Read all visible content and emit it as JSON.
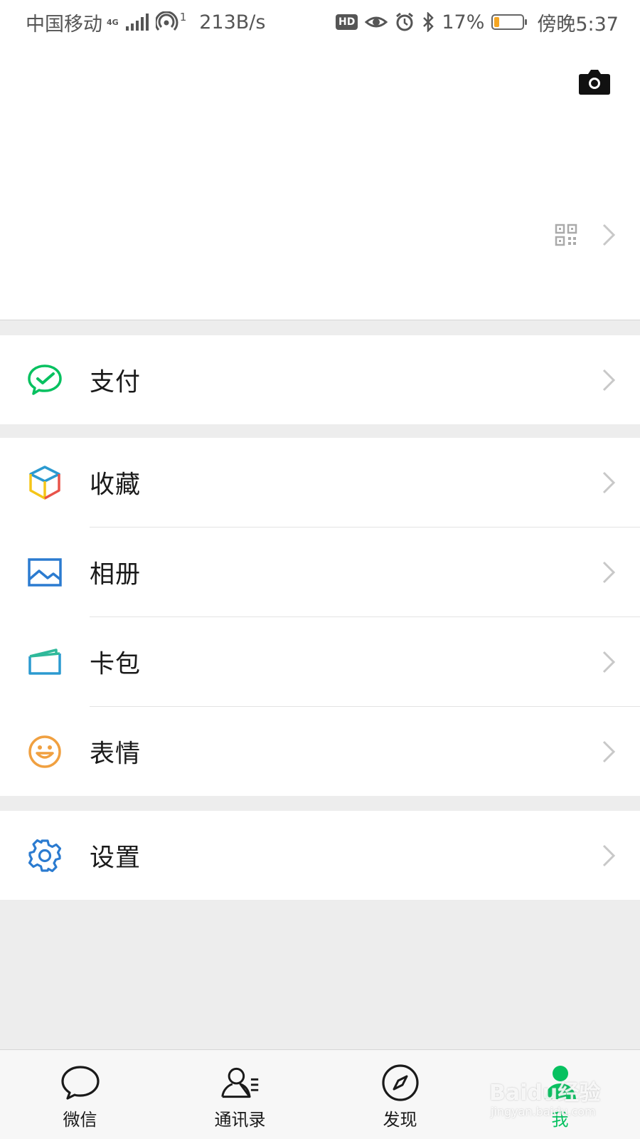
{
  "status_bar": {
    "carrier": "中国移动",
    "network": "4G",
    "hotspot_count": "1",
    "speed": "213B/s",
    "hd_badge": "HD",
    "battery_percent": "17%",
    "battery_level": 0.17,
    "time": "傍晚5:37"
  },
  "profile": {
    "camera_icon": "camera-icon",
    "qr_icon": "qr-code-icon"
  },
  "menu": {
    "pay": {
      "label": "支付",
      "icon": "wechat-pay-icon",
      "color": "#07c160"
    },
    "favorites": {
      "label": "收藏",
      "icon": "cube-icon"
    },
    "album": {
      "label": "相册",
      "icon": "picture-icon",
      "color": "#2b7bd0"
    },
    "cards": {
      "label": "卡包",
      "icon": "wallet-icon",
      "color": "#2b9ad0"
    },
    "stickers": {
      "label": "表情",
      "icon": "smiley-icon",
      "color": "#f0a040"
    },
    "settings": {
      "label": "设置",
      "icon": "gear-icon",
      "color": "#2b7bd0"
    }
  },
  "tabbar": {
    "chats": "微信",
    "contacts": "通讯录",
    "discover": "发现",
    "me": "我",
    "active_color": "#07c160"
  },
  "watermark": {
    "text": "Baidu经验",
    "sub": "jingyan.baidu.com"
  }
}
